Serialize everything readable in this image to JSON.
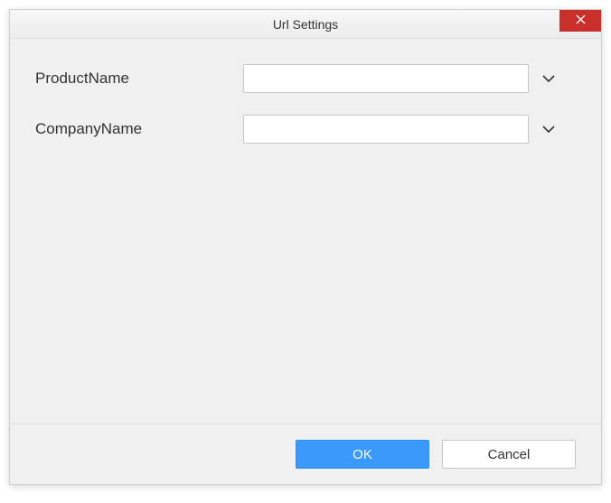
{
  "dialog": {
    "title": "Url Settings"
  },
  "form": {
    "fields": [
      {
        "label": "ProductName",
        "value": ""
      },
      {
        "label": "CompanyName",
        "value": ""
      }
    ]
  },
  "buttons": {
    "ok": "OK",
    "cancel": "Cancel"
  }
}
